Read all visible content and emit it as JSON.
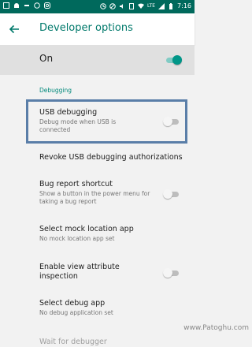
{
  "status_bar": {
    "icons_left": [
      "photo-icon",
      "android-icon",
      "bar-icon",
      "whatsapp-icon",
      "instagram-icon",
      "clock-icon",
      "block-icon",
      "volume-icon",
      "sim-icon"
    ],
    "network": "LTE",
    "time": "7:16"
  },
  "header": {
    "title": "Developer options"
  },
  "master": {
    "label": "On",
    "enabled": true
  },
  "section": {
    "title": "Debugging"
  },
  "prefs": [
    {
      "title": "USB debugging",
      "summary": "Debug mode when USB is connected",
      "toggle": false
    },
    {
      "title": "Revoke USB debugging authorizations",
      "summary": ""
    },
    {
      "title": "Bug report shortcut",
      "summary": "Show a button in the power menu for taking a bug report",
      "toggle": false
    },
    {
      "title": "Select mock location app",
      "summary": "No mock location app set"
    },
    {
      "title": "Enable view attribute inspection",
      "summary": "",
      "toggle": false
    },
    {
      "title": "Select debug app",
      "summary": "No debug application set"
    },
    {
      "title": "Wait for debugger",
      "summary": ""
    }
  ],
  "watermark": "www.Patoghu.com",
  "colors": {
    "accent": "#009688",
    "status_bar": "#00695c",
    "highlight": "#5a7ea8"
  }
}
